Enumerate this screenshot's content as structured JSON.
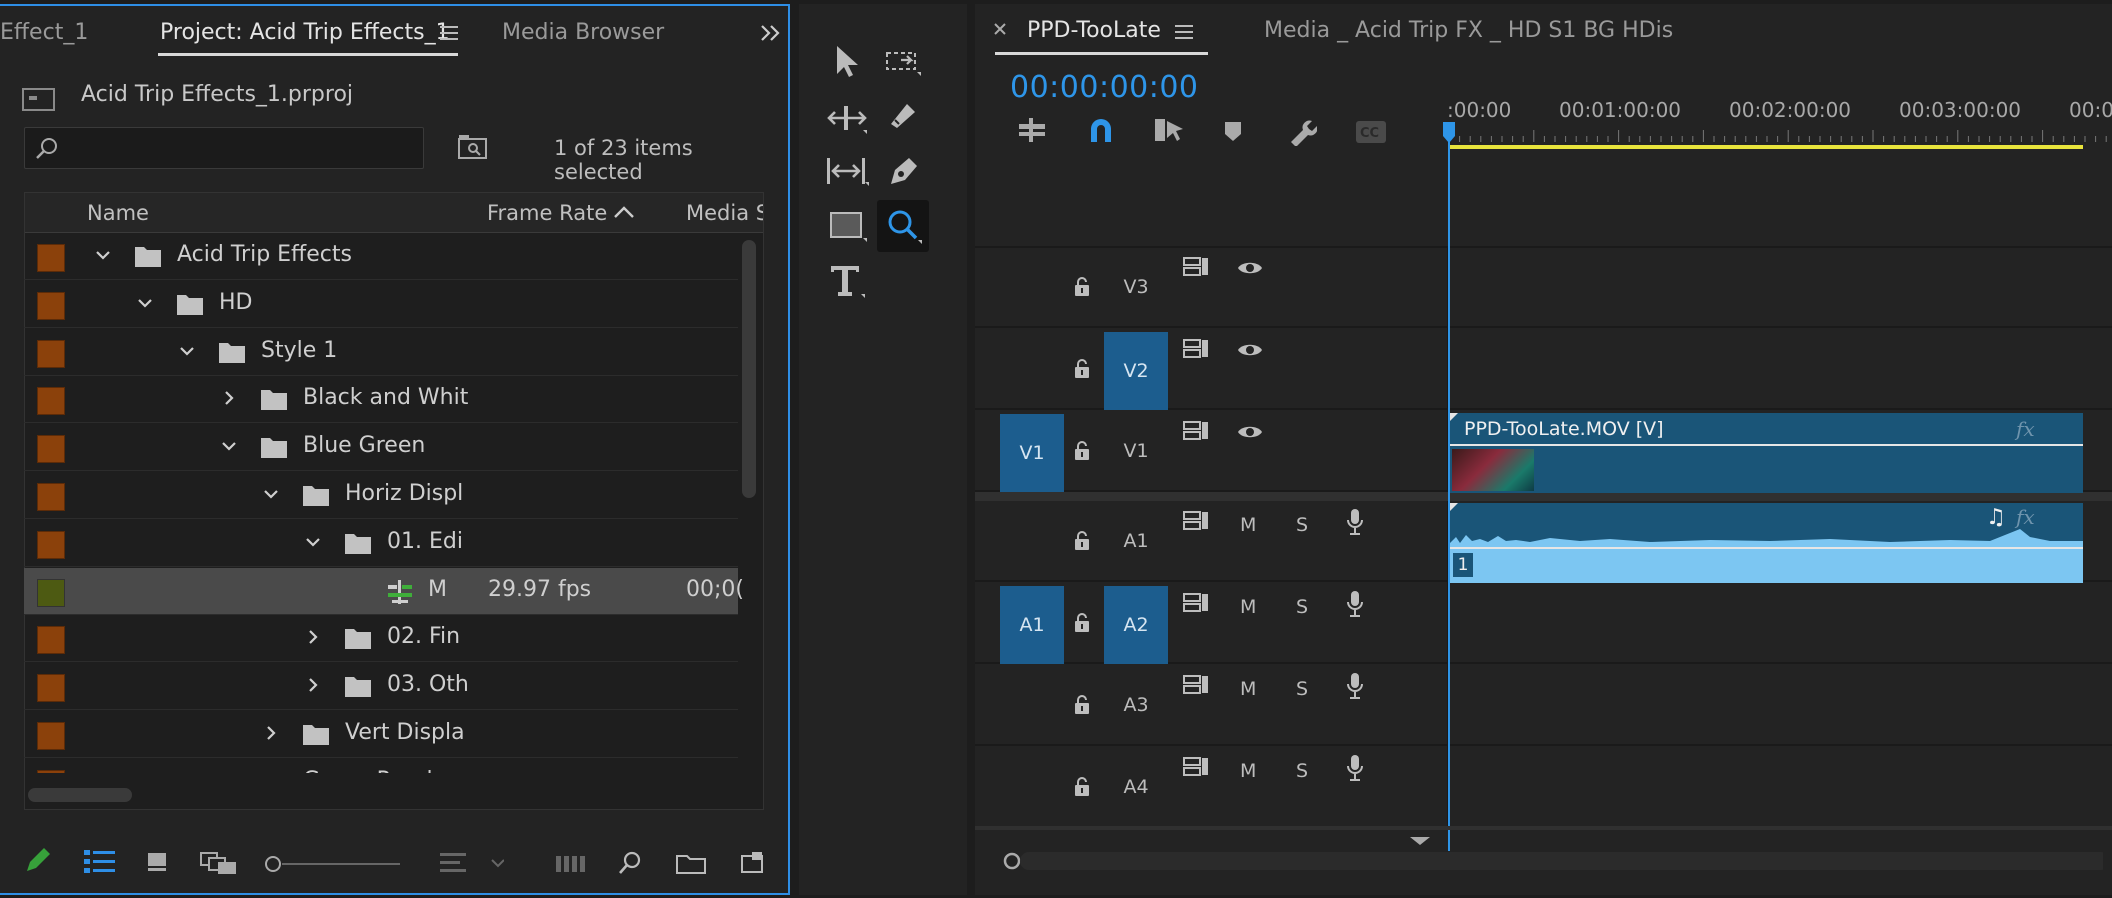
{
  "project_panel": {
    "tabs": [
      "Effect_1",
      "Project: Acid Trip Effects_1",
      "Media Browser"
    ],
    "file_name": "Acid Trip Effects_1.prproj",
    "search_placeholder": "",
    "selection_status": "1 of 23 items selected",
    "columns": [
      "Name",
      "Frame Rate",
      "Media S"
    ],
    "rows": [
      {
        "label": "Acid Trip Effects",
        "indent": 0,
        "expanded": true,
        "type": "folder"
      },
      {
        "label": "HD",
        "indent": 1,
        "expanded": true,
        "type": "folder"
      },
      {
        "label": "Style 1",
        "indent": 2,
        "expanded": true,
        "type": "folder"
      },
      {
        "label": "Black and Whit",
        "indent": 3,
        "expanded": false,
        "type": "folder"
      },
      {
        "label": "Blue Green",
        "indent": 3,
        "expanded": true,
        "type": "folder"
      },
      {
        "label": "Horiz Displ",
        "indent": 4,
        "expanded": true,
        "type": "folder"
      },
      {
        "label": "01. Edi",
        "indent": 5,
        "expanded": true,
        "type": "folder"
      },
      {
        "label": "M",
        "indent": 6,
        "type": "sequence",
        "frame_rate": "29.97 fps",
        "media_start": "00;0(",
        "selected": true
      },
      {
        "label": "02. Fin",
        "indent": 5,
        "expanded": false,
        "type": "folder"
      },
      {
        "label": "03. Oth",
        "indent": 5,
        "expanded": false,
        "type": "folder"
      },
      {
        "label": "Vert Displa",
        "indent": 4,
        "expanded": false,
        "type": "folder"
      },
      {
        "label": "Green Purple",
        "indent": 3,
        "expanded": false,
        "type": "folder"
      }
    ],
    "colors": {
      "folder_label": "#8b410b",
      "sequence_label": "#4d5a12",
      "accent": "#2e8ee6"
    }
  },
  "timeline_panel": {
    "sequence_tab": "PPD-TooLate",
    "second_tab": "Media _ Acid Trip FX _ HD S1 BG HDis",
    "timecode": "00:00:00:00",
    "ruler": [
      ":00:00",
      "00:01:00:00",
      "00:02:00:00",
      "00:03:00:00",
      "00:0"
    ],
    "video_tracks": [
      {
        "name": "V3",
        "source": ""
      },
      {
        "name": "V2",
        "source": ""
      },
      {
        "name": "V1",
        "source": "V1"
      }
    ],
    "audio_tracks": [
      {
        "name": "A1",
        "source": "",
        "m": "M",
        "s": "S"
      },
      {
        "name": "A2",
        "source": "A1",
        "m": "M",
        "s": "S"
      },
      {
        "name": "A3",
        "source": "",
        "m": "M",
        "s": "S"
      },
      {
        "name": "A4",
        "source": "",
        "m": "M",
        "s": "S"
      }
    ],
    "video_clip": {
      "label": "PPD-TooLate.MOV [V]",
      "fx": "fx"
    },
    "audio_clip": {
      "channel": "1",
      "fx": "fx"
    },
    "colors": {
      "timecode": "#2e95e8",
      "video_clip": "#1a5578",
      "audio_clip": "#7cc6f2",
      "work_area": "#e8e43c"
    }
  }
}
